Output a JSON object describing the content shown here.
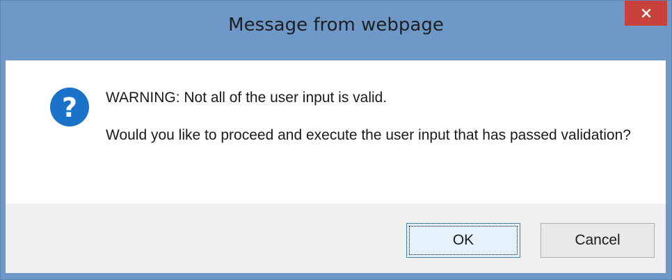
{
  "dialog": {
    "title": "Message from webpage",
    "close_glyph": "✕",
    "icon": "question-icon",
    "icon_glyph": "?",
    "message_line1": "WARNING: Not all of the user input is valid.",
    "message_line2": "Would you like to proceed and execute the user input that has passed validation?",
    "buttons": {
      "ok_label": "OK",
      "cancel_label": "Cancel"
    }
  },
  "colors": {
    "titlebar": "#6e98c8",
    "close_button": "#c8413b",
    "icon_blue": "#1a73c9",
    "footer": "#f0f0f0"
  }
}
